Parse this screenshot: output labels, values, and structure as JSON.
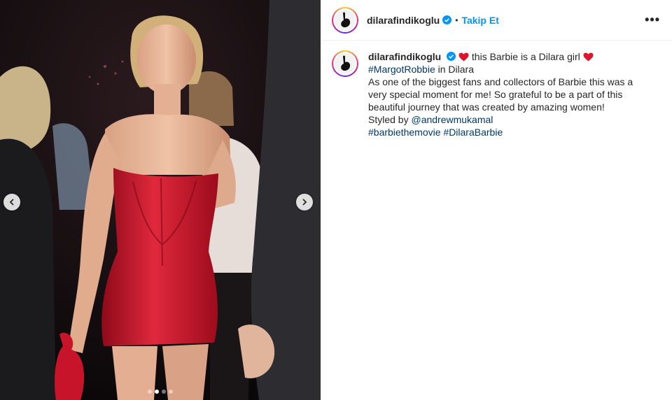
{
  "post": {
    "username": "dilarafindikoglu",
    "follow_label": "Takip Et",
    "more_label": "•••",
    "separator": "•"
  },
  "carousel": {
    "slide_count": 4,
    "active_index": 1
  },
  "caption": {
    "username": "dilarafindikoglu",
    "line1": "this Barbie is a Dilara girl",
    "mention_tag": "#MargotRobbie",
    "line2_rest": " in Dilara",
    "line3": "As one of the biggest fans and collectors of Barbie this was a",
    "line4": "very special moment for me! So grateful to be a part of this",
    "line5": "beautiful journey that was created by amazing women!",
    "styled_by": "Styled by ",
    "stylist": "@andrewmukamal",
    "tag1": "#barbiethemovie",
    "tag2": "#DilaraBarbie"
  },
  "colors": {
    "accent": "#0095f6",
    "link": "#00376b",
    "dress": "#c8142a",
    "heart": "#e0142c"
  }
}
